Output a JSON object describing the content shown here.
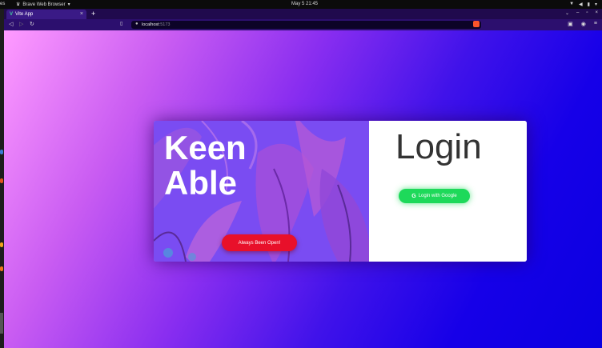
{
  "system": {
    "activities": "es",
    "app_menu": "Brave Web Browser",
    "clock": "May 5  21:45"
  },
  "browser": {
    "tab_title": "Vite App",
    "url_host": "localhost",
    "url_port": ":5173"
  },
  "card": {
    "brand_line1": "Keen",
    "brand_line2": "Able",
    "always_open_label": "Always Been Open!",
    "login_title": "Login",
    "google_label": "Login with Google"
  },
  "colors": {
    "open_button": "#e8102a",
    "google_button": "#1ed95a",
    "panel_purple": "#7a4cf2"
  }
}
